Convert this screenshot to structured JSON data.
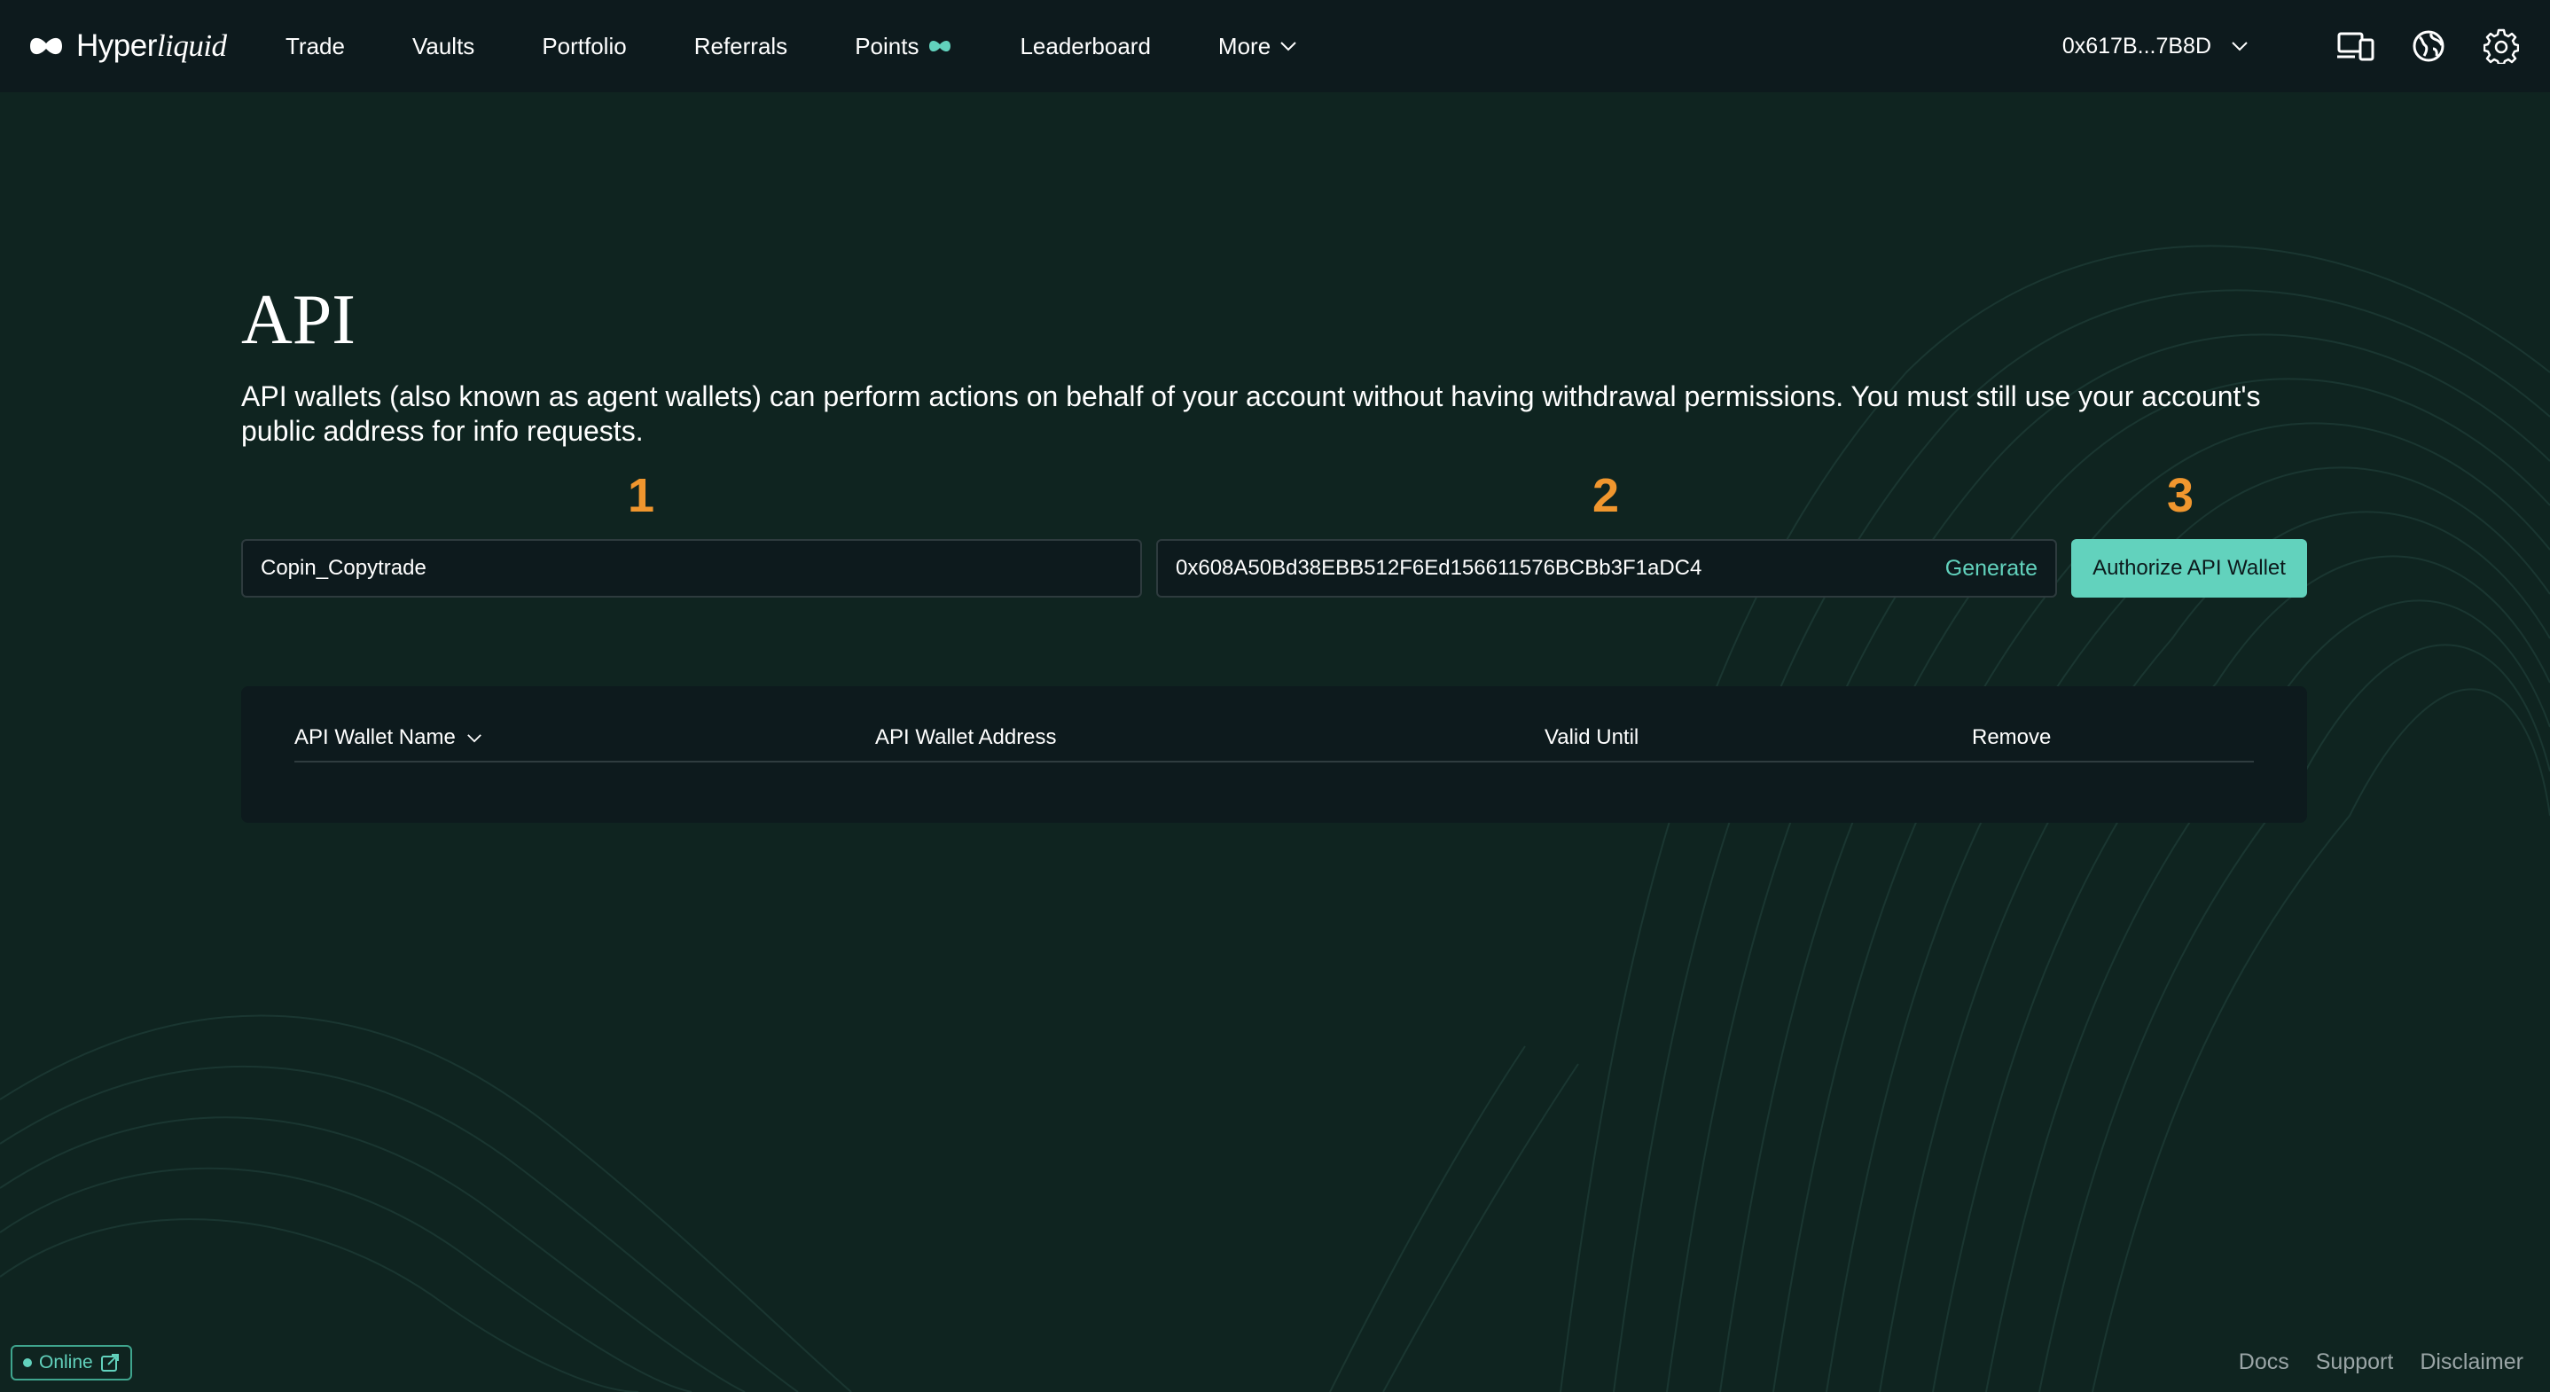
{
  "brand": {
    "name_regular": "Hyper",
    "name_italic": "liquid"
  },
  "nav": {
    "items": [
      {
        "label": "Trade"
      },
      {
        "label": "Vaults"
      },
      {
        "label": "Portfolio"
      },
      {
        "label": "Referrals"
      },
      {
        "label": "Points"
      },
      {
        "label": "Leaderboard"
      },
      {
        "label": "More"
      }
    ]
  },
  "header": {
    "wallet_address": "0x617B...7B8D"
  },
  "page": {
    "title": "API",
    "description": "API wallets (also known as agent wallets) can perform actions on behalf of your account without having withdrawal permissions. You must still use your account's public address for info requests."
  },
  "steps": [
    "1",
    "2",
    "3"
  ],
  "form": {
    "name_value": "Copin_Copytrade",
    "address_value": "0x608A50Bd38EBB512F6Ed156611576BCBb3F1aDC4",
    "generate_label": "Generate",
    "authorize_label": "Authorize API Wallet"
  },
  "table": {
    "columns": [
      "API Wallet Name",
      "API Wallet Address",
      "Valid Until",
      "Remove"
    ]
  },
  "status": {
    "label": "Online"
  },
  "footer": {
    "links": [
      "Docs",
      "Support",
      "Disclaimer"
    ]
  },
  "colors": {
    "background": "#0f2420",
    "navbar": "#0d1a1d",
    "accent": "#62d2bd",
    "step_number": "#f0962e"
  }
}
